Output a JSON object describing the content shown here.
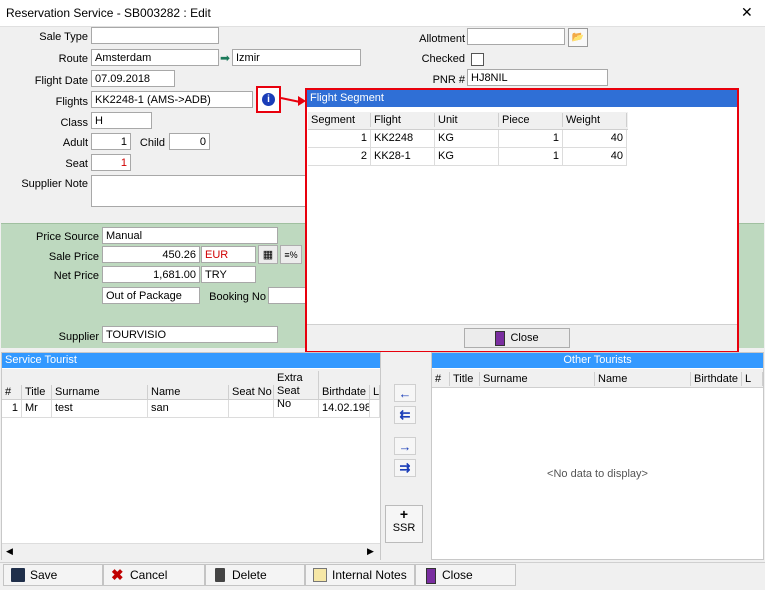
{
  "window": {
    "title": "Reservation Service - SB003282 : Edit",
    "close_glyph": "✕"
  },
  "form": {
    "sale_type_label": "Sale Type",
    "sale_type_value": "",
    "route_label": "Route",
    "route_from": "Amsterdam",
    "route_to": "Izmir",
    "flight_date_label": "Flight Date",
    "flight_date_value": "07.09.2018",
    "flights_label": "Flights",
    "flights_value": "KK2248-1 (AMS->ADB)",
    "class_label": "Class",
    "class_value": "H",
    "adult_label": "Adult",
    "adult_value": "1",
    "child_label": "Child",
    "child_value": "0",
    "seat_label": "Seat",
    "seat_value": "1",
    "supplier_note_label": "Supplier Note",
    "supplier_note_value": "",
    "allotment_label": "Allotment",
    "allotment_value": "",
    "checked_label": "Checked",
    "pnr_label": "PNR #",
    "pnr_value": "HJ8NIL"
  },
  "price": {
    "price_source_label": "Price Source",
    "price_source_value": "Manual",
    "sale_price_label": "Sale Price",
    "sale_price_value": "450.26",
    "sale_currency": "EUR",
    "net_price_label": "Net Price",
    "net_price_value": "1,681.00",
    "net_currency": "TRY",
    "package_value": "Out of Package",
    "booking_no_label": "Booking No",
    "booking_no_value": "",
    "supplier_label": "Supplier",
    "supplier_value": "TOURVISIO",
    "calc_glyph": "▦",
    "percent_glyph": "≡%"
  },
  "flight_segment": {
    "title": "Flight Segment",
    "columns": [
      "Segment",
      "Flight",
      "Unit",
      "Piece",
      "Weight"
    ],
    "rows": [
      {
        "segment": "1",
        "flight": "KK2248",
        "unit": "KG",
        "piece": "1",
        "weight": "40"
      },
      {
        "segment": "2",
        "flight": "KK28-1",
        "unit": "KG",
        "piece": "1",
        "weight": "40"
      }
    ],
    "close_label": "Close"
  },
  "service_tourist": {
    "title": "Service Tourist",
    "columns": [
      "#",
      "Title",
      "Surname",
      "Name",
      "Seat No",
      "Extra\nSeat No",
      "Birthdate",
      "L"
    ],
    "rows": [
      {
        "num": "1",
        "title": "Mr",
        "surname": "test",
        "name": "san",
        "seat": "",
        "extra": "",
        "birthdate": "14.02.198"
      }
    ]
  },
  "other_tourists": {
    "title": "Other Tourists",
    "columns": [
      "#",
      "Title",
      "Surname",
      "Name",
      "Birthdate",
      "L"
    ],
    "empty_text": "<No data to display>"
  },
  "transfer": {
    "left_one": "←",
    "left_all": "⇇",
    "right_one": "→",
    "right_all": "⇉",
    "ssr_plus": "+",
    "ssr_label": "SSR"
  },
  "bottom": {
    "save": "Save",
    "cancel": "Cancel",
    "delete": "Delete",
    "internal_notes": "Internal Notes",
    "close": "Close"
  },
  "colors": {
    "green_panel": "#bed9bf",
    "selection_blue": "#3399ff",
    "popup_red": "#e8000d",
    "popup_title": "#2f6fd6"
  }
}
